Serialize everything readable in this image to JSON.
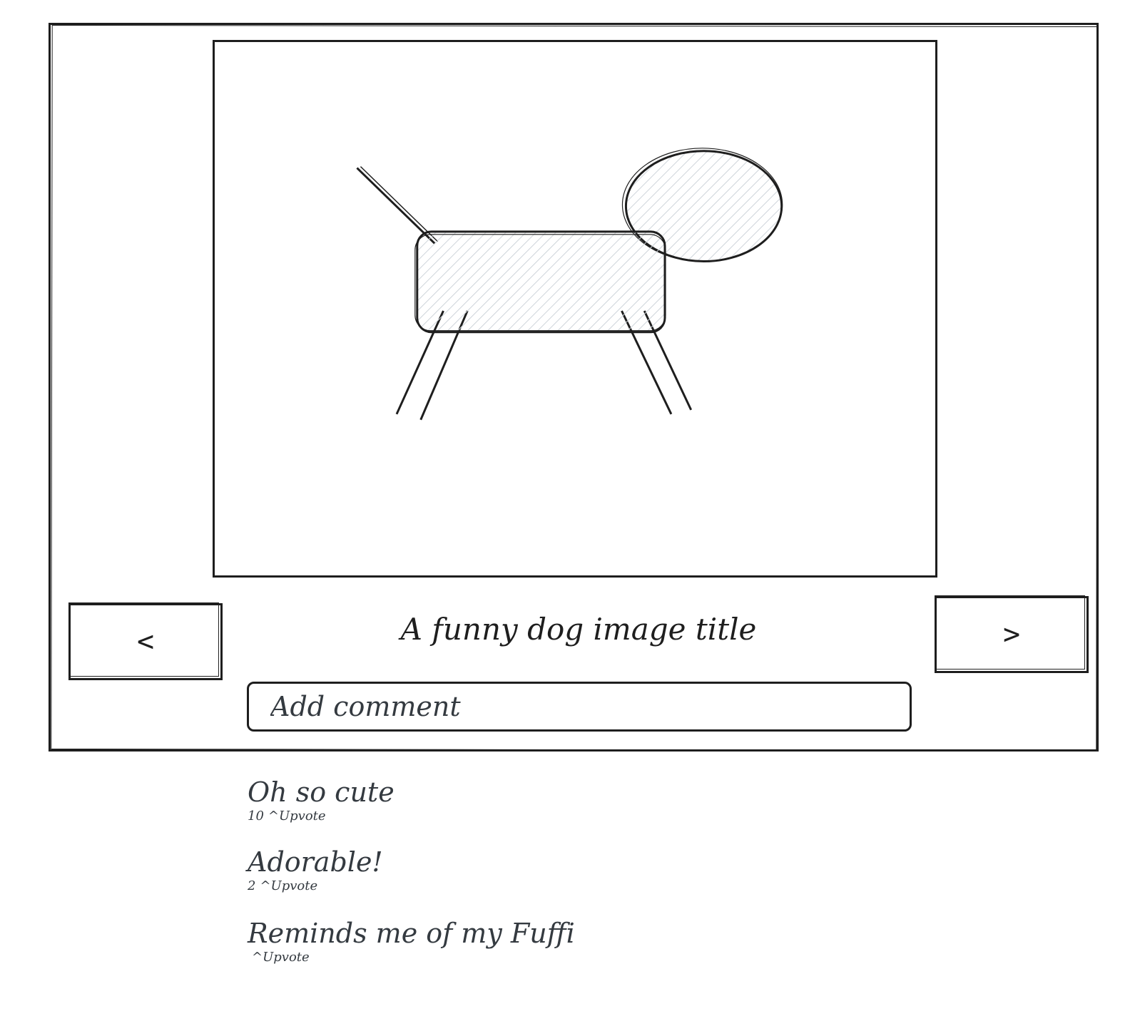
{
  "image": {
    "title": "A funny dog image title",
    "colors": {
      "stroke": "#1e1e1e",
      "hatch": "#ced4da"
    },
    "icon": "dog-sketch"
  },
  "nav": {
    "prev_label": "<",
    "next_label": ">"
  },
  "comment_input": {
    "placeholder": "Add comment"
  },
  "comments": [
    {
      "text": "Oh so cute",
      "votes": "10",
      "upvote_label": "^Upvote"
    },
    {
      "text": "Adorable!",
      "votes": "2",
      "upvote_label": "^Upvote"
    },
    {
      "text": "Reminds me of my Fuffi",
      "votes": "",
      "upvote_label": "^Upvote"
    }
  ]
}
